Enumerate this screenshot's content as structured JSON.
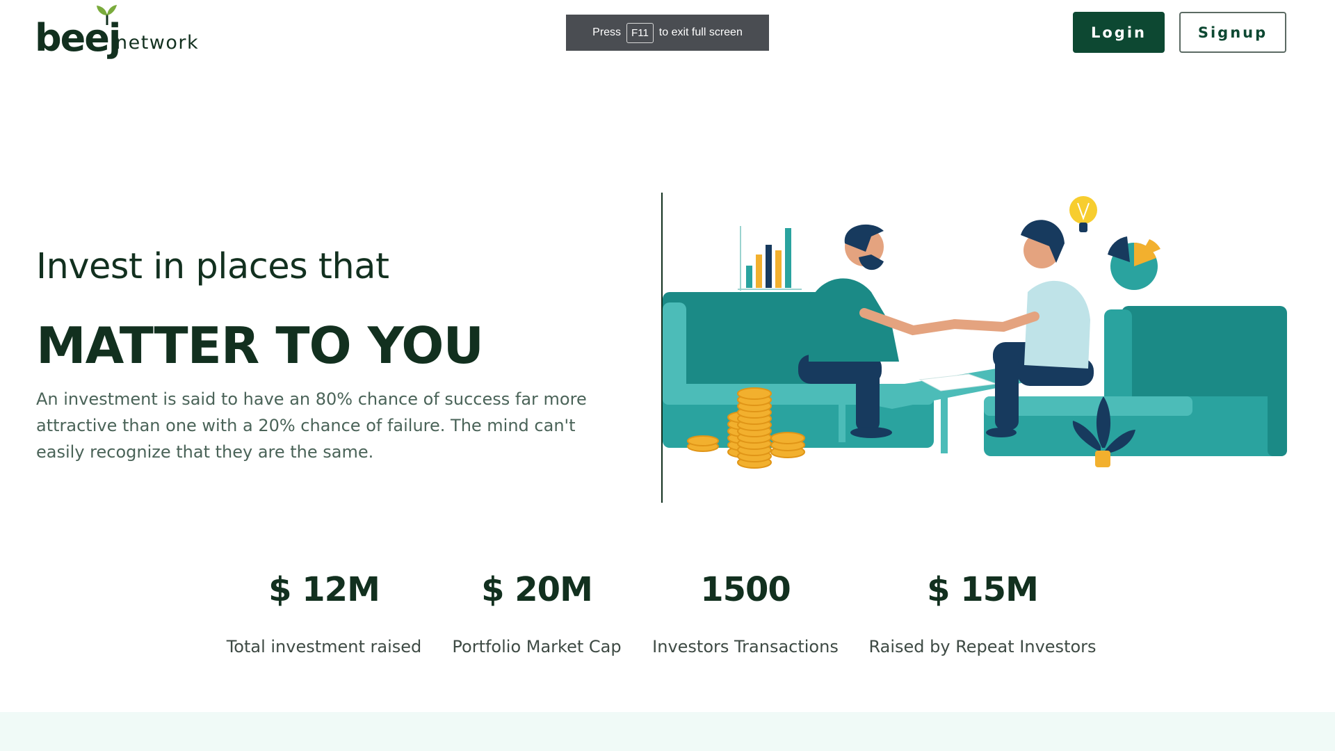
{
  "brand": {
    "name": "beej",
    "sub": "network",
    "color": "#12301f",
    "leaf_color": "#7aab3c"
  },
  "fullscreen_notice": {
    "prefix": "Press",
    "key": "F11",
    "suffix": "to exit full screen"
  },
  "nav": {
    "login_label": "Login",
    "signup_label": "Signup",
    "accent": "#0d4832"
  },
  "hero": {
    "lead": "Invest in places that",
    "title": "MATTER TO YOU",
    "description": "An investment is said to have an 80% chance of success far more attractive than one with a 20% chance of failure. The mind can't easily recognize that they are the same.",
    "illustration": "two-people-handshake-on-sofas",
    "illustration_icons": [
      "bar-chart-icon",
      "lightbulb-icon",
      "pie-chart-icon",
      "coins-icon",
      "plant-icon"
    ]
  },
  "stats": [
    {
      "value": "$ 12M",
      "label": "Total investment raised"
    },
    {
      "value": "$ 20M",
      "label": "Portfolio Market Cap"
    },
    {
      "value": "1500",
      "label": "Investors Transactions"
    },
    {
      "value": "$ 15M",
      "label": "Raised by Repeat Investors"
    }
  ],
  "colors": {
    "teal": "#2aa39f",
    "teal_dark": "#1b8a86",
    "navy": "#173a5e",
    "gold": "#f2b02e",
    "band": "#f0faf7"
  }
}
